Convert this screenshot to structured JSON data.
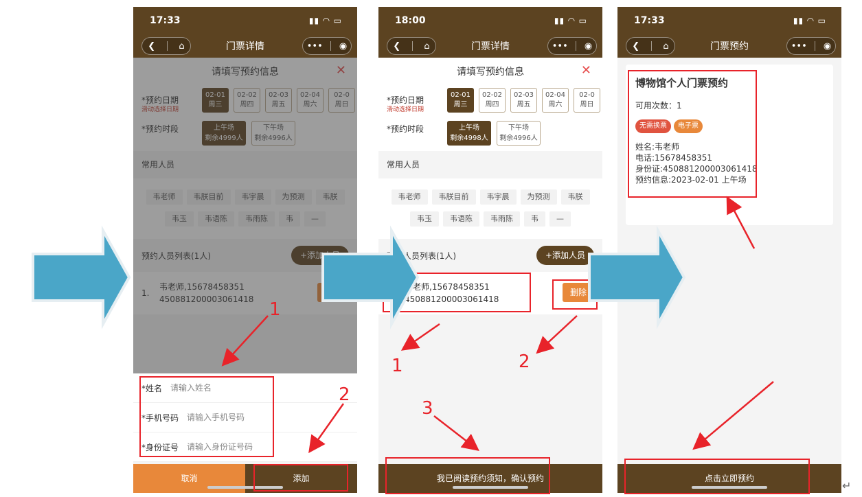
{
  "phones": [
    {
      "time": "17:33",
      "nav_title": "门票详情",
      "sheet_title": "请填写预约信息",
      "date_label": "*预约日期",
      "date_hint": "滑动选择日期",
      "dates": [
        {
          "d": "02-01",
          "w": "周三"
        },
        {
          "d": "02-02",
          "w": "周四"
        },
        {
          "d": "02-03",
          "w": "周五"
        },
        {
          "d": "02-04",
          "w": "周六"
        },
        {
          "d": "02-0",
          "w": "周日"
        }
      ],
      "slot_label": "*预约时段",
      "slots": [
        {
          "name": "上午场",
          "remain": "剩余4999人"
        },
        {
          "name": "下午场",
          "remain": "剩余4996人"
        }
      ],
      "people_header": "常用人员",
      "people": [
        "韦老师",
        "韦朕目前",
        "韦宇晨",
        "为预测",
        "韦朕",
        "韦玉",
        "韦语陈",
        "韦雨陈",
        "韦",
        "—"
      ],
      "list_header": "预约人员列表(1人)",
      "add_button": "+添加人员",
      "entry_index": "1.",
      "entry_line1": "韦老师,15678458351",
      "entry_line2": "450881200003061418",
      "delete_button": "删除",
      "form": {
        "name_label": "*姓名",
        "name_placeholder": "请输入姓名",
        "phone_label": "*手机号码",
        "phone_placeholder": "请输入手机号码",
        "id_label": "*身份证号",
        "id_placeholder": "请输入身份证号码"
      },
      "cancel_button": "取消",
      "confirm_button": "添加"
    },
    {
      "time": "18:00",
      "nav_title": "门票详情",
      "sheet_title": "请填写预约信息",
      "date_label": "*预约日期",
      "date_hint": "滑动选择日期",
      "dates": [
        {
          "d": "02-01",
          "w": "周三"
        },
        {
          "d": "02-02",
          "w": "周四"
        },
        {
          "d": "02-03",
          "w": "周五"
        },
        {
          "d": "02-04",
          "w": "周六"
        },
        {
          "d": "02-0",
          "w": "周日"
        }
      ],
      "slot_label": "*预约时段",
      "slots": [
        {
          "name": "上午场",
          "remain": "剩余4998人"
        },
        {
          "name": "下午场",
          "remain": "剩余4996人"
        }
      ],
      "people_header": "常用人员",
      "people": [
        "韦老师",
        "韦朕目前",
        "韦宇晨",
        "为预测",
        "韦朕",
        "韦玉",
        "韦语陈",
        "韦雨陈",
        "韦",
        "—"
      ],
      "list_header": "预约人员列表(1人)",
      "add_button": "+添加人员",
      "entry_index": "1.",
      "entry_line1": "韦老师,15678458351",
      "entry_line2": "450881200003061418",
      "delete_button": "删除",
      "confirm_button": "我已阅读预约须知，确认预约"
    },
    {
      "time": "17:33",
      "nav_title": "门票预约",
      "card_title": "博物馆个人门票预约",
      "count": "可用次数：1",
      "badges": [
        "无需换票",
        "电子票"
      ],
      "name": "姓名:韦老师",
      "phone": "电话:15678458351",
      "idcard": "身份证:450881200003061418",
      "booking": "预约信息:2023-02-01 上午场",
      "confirm_button": "点击立即预约"
    }
  ],
  "annotations": {
    "step_a": [
      "1",
      "2"
    ],
    "step_b": [
      "1",
      "2",
      "3"
    ]
  },
  "colors": {
    "brand": "#5c4321",
    "accent": "#e8883a",
    "annotation": "#e8232a",
    "arrow": "#4aa6c8",
    "badge_red": "#e0533f",
    "badge_orange": "#e8883a"
  },
  "trailing_mark": "↵"
}
